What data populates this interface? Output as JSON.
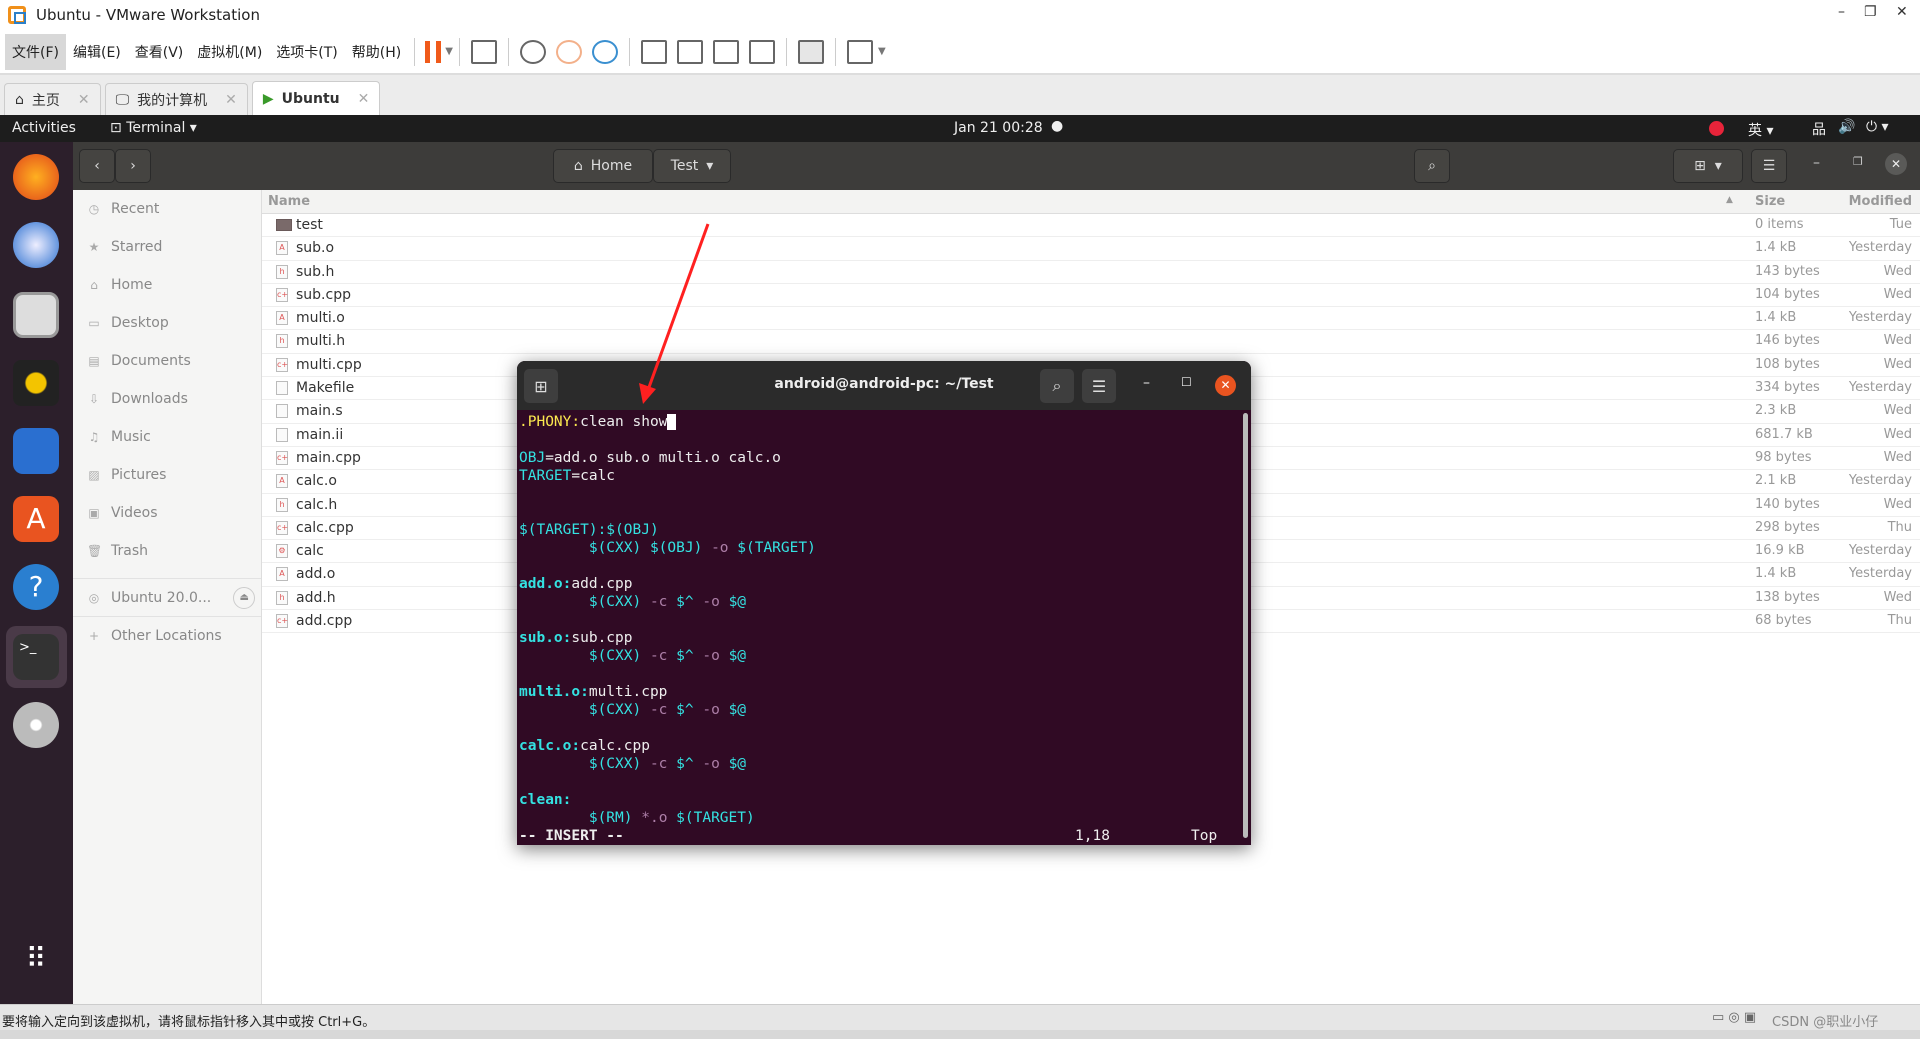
{
  "window": {
    "title": "Ubuntu - VMware Workstation",
    "min": "–",
    "restore": "❐",
    "close": "✕"
  },
  "menu": [
    "文件(F)",
    "编辑(E)",
    "查看(V)",
    "虚拟机(M)",
    "选项卡(T)",
    "帮助(H)"
  ],
  "vm_tabs": [
    {
      "label": "主页",
      "icon": "home-icon"
    },
    {
      "label": "我的计算机",
      "icon": "monitor-icon"
    },
    {
      "label": "Ubuntu",
      "icon": "vm-running-icon",
      "active": true
    }
  ],
  "topbar": {
    "activities": "Activities",
    "app": "Terminal",
    "datetime": "Jan 21  00:28",
    "input_method": "英"
  },
  "files": {
    "path": [
      "Home",
      "Test"
    ],
    "columns": {
      "name": "Name",
      "size": "Size",
      "modified": "Modified"
    },
    "sidebar": [
      "Recent",
      "Starred",
      "Home",
      "Desktop",
      "Documents",
      "Downloads",
      "Music",
      "Pictures",
      "Videos",
      "Trash",
      "Ubuntu 20.0...",
      "Other Locations"
    ],
    "rows": [
      {
        "name": "test",
        "size": "0 items",
        "modified": "Tue",
        "type": "folder"
      },
      {
        "name": "sub.o",
        "size": "1.4 kB",
        "modified": "Yesterday",
        "type": "obj"
      },
      {
        "name": "sub.h",
        "size": "143 bytes",
        "modified": "Wed",
        "type": "h"
      },
      {
        "name": "sub.cpp",
        "size": "104 bytes",
        "modified": "Wed",
        "type": "cpp"
      },
      {
        "name": "multi.o",
        "size": "1.4 kB",
        "modified": "Yesterday",
        "type": "obj"
      },
      {
        "name": "multi.h",
        "size": "146 bytes",
        "modified": "Wed",
        "type": "h"
      },
      {
        "name": "multi.cpp",
        "size": "108 bytes",
        "modified": "Wed",
        "type": "cpp"
      },
      {
        "name": "Makefile",
        "size": "334 bytes",
        "modified": "Yesterday",
        "type": "make"
      },
      {
        "name": "main.s",
        "size": "2.3 kB",
        "modified": "Wed",
        "type": "txt"
      },
      {
        "name": "main.ii",
        "size": "681.7 kB",
        "modified": "Wed",
        "type": "txt"
      },
      {
        "name": "main.cpp",
        "size": "98 bytes",
        "modified": "Wed",
        "type": "cpp"
      },
      {
        "name": "calc.o",
        "size": "2.1 kB",
        "modified": "Yesterday",
        "type": "obj"
      },
      {
        "name": "calc.h",
        "size": "140 bytes",
        "modified": "Wed",
        "type": "h"
      },
      {
        "name": "calc.cpp",
        "size": "298 bytes",
        "modified": "Thu",
        "type": "cpp"
      },
      {
        "name": "calc",
        "size": "16.9 kB",
        "modified": "Yesterday",
        "type": "exec"
      },
      {
        "name": "add.o",
        "size": "1.4 kB",
        "modified": "Yesterday",
        "type": "obj"
      },
      {
        "name": "add.h",
        "size": "138 bytes",
        "modified": "Wed",
        "type": "h"
      },
      {
        "name": "add.cpp",
        "size": "68 bytes",
        "modified": "Thu",
        "type": "cpp"
      }
    ]
  },
  "terminal": {
    "title": "android@android-pc: ~/Test",
    "lines": [
      [
        [
          "y",
          ".PHONY:"
        ],
        [
          "",
          "clean show"
        ]
      ],
      [],
      [
        [
          "c",
          "OBJ"
        ],
        [
          "",
          "=add.o sub.o multi.o calc.o"
        ]
      ],
      [
        [
          "c",
          "TARGET"
        ],
        [
          "",
          "=calc"
        ]
      ],
      [],
      [],
      [
        [
          "c",
          "$(TARGET):$(OBJ)"
        ]
      ],
      [
        [
          "",
          "        "
        ],
        [
          "c",
          "$(CXX) $(OBJ) "
        ],
        [
          "m",
          "-o "
        ],
        [
          "c",
          "$(TARGET)"
        ]
      ],
      [],
      [
        [
          "k",
          "add.o:"
        ],
        [
          "",
          "add.cpp"
        ]
      ],
      [
        [
          "",
          "        "
        ],
        [
          "c",
          "$(CXX) "
        ],
        [
          "m",
          "-c "
        ],
        [
          "c",
          "$^ "
        ],
        [
          "m",
          "-o "
        ],
        [
          "c",
          "$@"
        ]
      ],
      [],
      [
        [
          "k",
          "sub.o:"
        ],
        [
          "",
          "sub.cpp"
        ]
      ],
      [
        [
          "",
          "        "
        ],
        [
          "c",
          "$(CXX) "
        ],
        [
          "m",
          "-c "
        ],
        [
          "c",
          "$^ "
        ],
        [
          "m",
          "-o "
        ],
        [
          "c",
          "$@"
        ]
      ],
      [],
      [
        [
          "k",
          "multi.o:"
        ],
        [
          "",
          "multi.cpp"
        ]
      ],
      [
        [
          "",
          "        "
        ],
        [
          "c",
          "$(CXX) "
        ],
        [
          "m",
          "-c "
        ],
        [
          "c",
          "$^ "
        ],
        [
          "m",
          "-o "
        ],
        [
          "c",
          "$@"
        ]
      ],
      [],
      [
        [
          "k",
          "calc.o:"
        ],
        [
          "",
          "calc.cpp"
        ]
      ],
      [
        [
          "",
          "        "
        ],
        [
          "c",
          "$(CXX) "
        ],
        [
          "m",
          "-c "
        ],
        [
          "c",
          "$^ "
        ],
        [
          "m",
          "-o "
        ],
        [
          "c",
          "$@"
        ]
      ],
      [],
      [
        [
          "k",
          "clean:"
        ]
      ],
      [
        [
          "",
          "        "
        ],
        [
          "c",
          "$(RM) "
        ],
        [
          "m",
          "*.o "
        ],
        [
          "c",
          "$(TARGET)"
        ]
      ]
    ],
    "mode": "-- INSERT --",
    "position": "1,18",
    "scroll": "Top"
  },
  "statusbar": {
    "message": "要将输入定向到该虚拟机，请将鼠标指针移入其中或按 Ctrl+G。",
    "watermark": "CSDN @职业小仔"
  },
  "colors": {
    "terminal_bg": "#300a24",
    "accent": "#e95420",
    "annotation_arrow": "#ff2020"
  }
}
